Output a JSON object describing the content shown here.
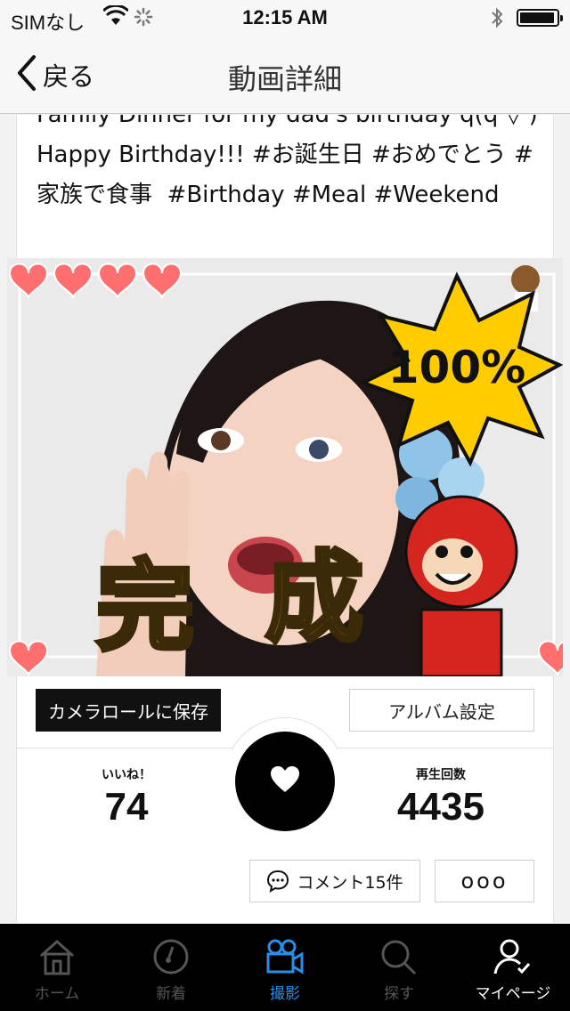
{
  "status_bar": {
    "carrier": "SIMなし",
    "time": "12:15 AM",
    "battery_level": 0.95
  },
  "nav": {
    "back_label": "戻る",
    "title": "動画詳細"
  },
  "post": {
    "description": "Family Dinner for my dad's birthday q(q'▽')\nHappy Birthday!!! #お誕生日 #おめでとう #\n家族で食事  #Birthday #Meal #Weekend"
  },
  "media": {
    "badge_text": "100%",
    "caption_left": "完",
    "caption_right": "成"
  },
  "actions": {
    "save_label": "カメラロールに保存",
    "album_label": "アルバム設定"
  },
  "stats": {
    "likes_label": "いいね！",
    "likes_value": "74",
    "plays_label": "再生回数",
    "plays_value": "4435"
  },
  "comments": {
    "label": "コメント15件"
  },
  "more": {
    "label": "ooo"
  },
  "tabbar": [
    {
      "label": "ホーム",
      "icon": "home-icon"
    },
    {
      "label": "新着",
      "icon": "compass-icon"
    },
    {
      "label": "撮影",
      "icon": "video-camera-icon"
    },
    {
      "label": "探す",
      "icon": "search-icon"
    },
    {
      "label": "マイページ",
      "icon": "user-check-icon"
    }
  ],
  "colors": {
    "accent": "#2a8ee8",
    "badge": "#ffcc00",
    "heart": "#ff6f6f"
  }
}
